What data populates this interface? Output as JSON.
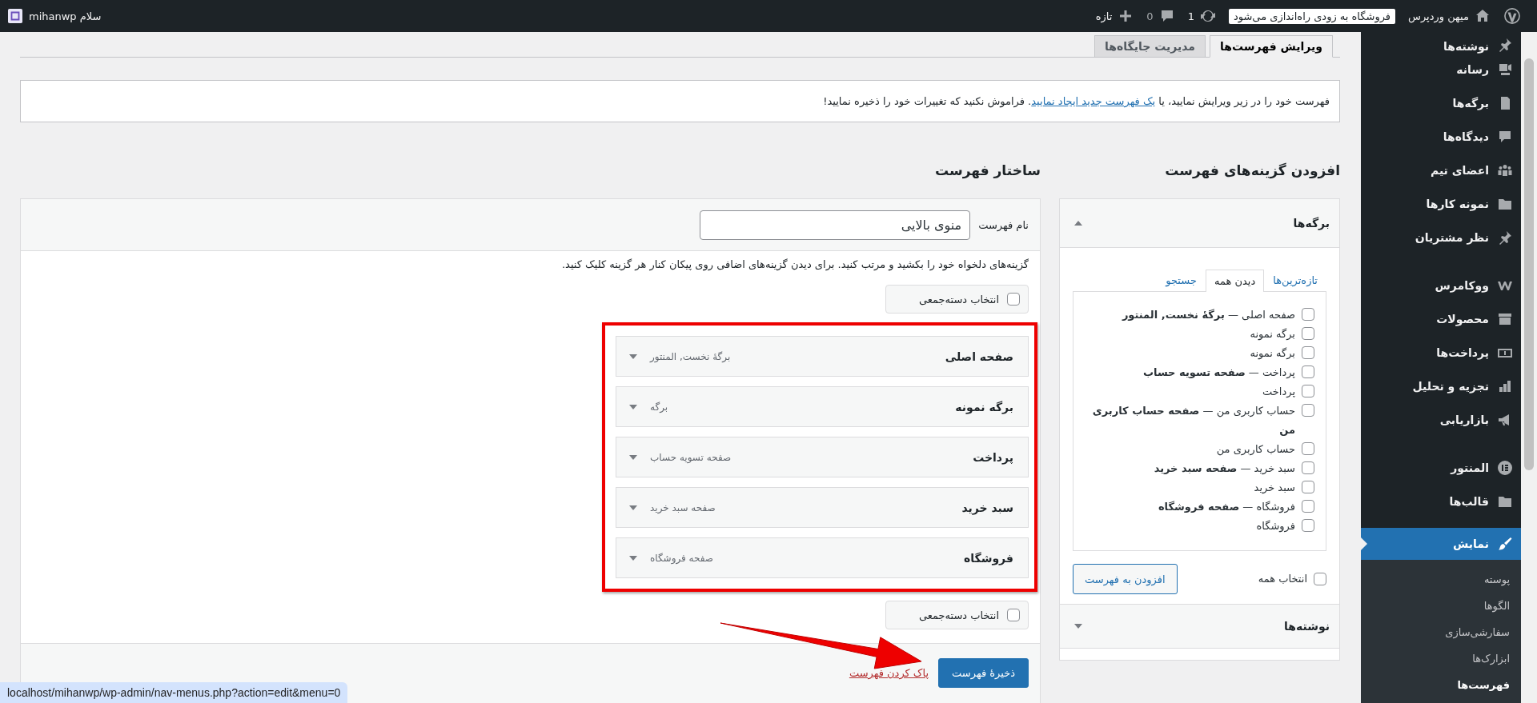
{
  "admin_bar": {
    "site_name": "میهن وردپرس",
    "notice": "فروشگاه به زودی راه‌اندازی می‌شود",
    "updates": "1",
    "comments": "0",
    "new_label": "تازه",
    "greeting": "سلام mihanwp"
  },
  "tabs": [
    {
      "label": "ویرایش فهرست‌ها",
      "selected": true
    },
    {
      "label": "مدیریت جایگاه‌ها",
      "selected": false
    }
  ],
  "notice": {
    "before": "فهرست خود را در زیر ویرایش نمایید، یا ",
    "link": "یک فهرست جدید ایجاد نمایید",
    "after": ". فراموش نکنید که تغییرات خود را ذخیره نمایید!"
  },
  "add_items": {
    "title": "افزودن گزینه‌های فهرست",
    "pages_box": {
      "title": "برگه‌ها",
      "expanded": true,
      "tabs": [
        {
          "label": "تازه‌ترین‌ها",
          "selected": false
        },
        {
          "label": "دیدن همه",
          "selected": true
        },
        {
          "label": "جستجو",
          "selected": false
        }
      ],
      "items": [
        {
          "label": "صفحه اصلی — **برگهٔ نخست, المنتور**",
          "checked": false
        },
        {
          "label": "برگه نمونه",
          "checked": false
        },
        {
          "label": "برگه نمونه",
          "checked": false
        },
        {
          "label": "پرداخت — **صفحه تسویه حساب**",
          "checked": false
        },
        {
          "label": "پرداخت",
          "checked": false
        },
        {
          "label": "حساب کاربری من — **صفحه حساب کاربری من**",
          "checked": false
        },
        {
          "label": "حساب کاربری من",
          "checked": false
        },
        {
          "label": "سبد خرید — **صفحه سبد خرید**",
          "checked": false
        },
        {
          "label": "سبد خرید",
          "checked": false
        },
        {
          "label": "فروشگاه — **صفحه فروشگاه**",
          "checked": false
        },
        {
          "label": "فروشگاه",
          "checked": false
        }
      ],
      "select_all": {
        "label": "انتخاب همه",
        "checked": false
      },
      "add_button": "افزودن به فهرست"
    },
    "posts_box": {
      "title": "نوشته‌ها",
      "expanded": false
    }
  },
  "menu_structure": {
    "title": "ساختار فهرست",
    "name_label": "نام فهرست",
    "name_value": "منوی بالایی",
    "instructions": "گزینه‌های دلخواه خود را بکشید و مرتب کنید. برای دیدن گزینه‌های اضافی روی پیکان کنار هر گزینه کلیک کنید.",
    "bulk_select_top": {
      "label": "انتخاب دسته‌جمعی",
      "checked": false
    },
    "items": [
      {
        "title": "صفحه اصلی",
        "type": "برگهٔ نخست, المنتور"
      },
      {
        "title": "برگه نمونه",
        "type": "برگه"
      },
      {
        "title": "پرداخت",
        "type": "صفحه تسویه حساب"
      },
      {
        "title": "سبد خرید",
        "type": "صفحه سبد خرید"
      },
      {
        "title": "فروشگاه",
        "type": "صفحه فروشگاه"
      }
    ],
    "bulk_select_bottom": {
      "label": "انتخاب دسته‌جمعی",
      "checked": false
    },
    "delete_link": "پاک کردن فهرست",
    "save_button": "ذخیرهٔ فهرست"
  },
  "sidebar": {
    "groups": [
      [
        {
          "label": "نوشته‌ها",
          "selected": false
        },
        {
          "label": "رسانه",
          "selected": false
        },
        {
          "label": "برگه‌ها",
          "selected": false
        },
        {
          "label": "دیدگاه‌ها",
          "selected": false
        },
        {
          "label": "اعضای تیم",
          "selected": false
        },
        {
          "label": "نمونه کارها",
          "selected": false
        },
        {
          "label": "نظر مشتریان",
          "selected": false
        }
      ],
      [
        {
          "label": "ووکامرس",
          "selected": false
        },
        {
          "label": "محصولات",
          "selected": false
        },
        {
          "label": "پرداخت‌ها",
          "selected": false
        },
        {
          "label": "تجزیه و تحلیل",
          "selected": false
        },
        {
          "label": "بازاریابی",
          "selected": false
        }
      ],
      [
        {
          "label": "المنتور",
          "selected": false
        },
        {
          "label": "قالب‌ها",
          "selected": false
        }
      ],
      [
        {
          "label": "نمایش",
          "selected": true,
          "children": [
            {
              "label": "پوسته",
              "selected": false
            },
            {
              "label": "الگوها",
              "selected": false
            },
            {
              "label": "سفارشی‌سازی",
              "selected": false
            },
            {
              "label": "ابزارک‌ها",
              "selected": false
            },
            {
              "label": "فهرست‌ها",
              "selected": true
            }
          ]
        }
      ]
    ]
  },
  "status_url": "localhost/mihanwp/wp-admin/nav-menus.php?action=edit&menu=0"
}
